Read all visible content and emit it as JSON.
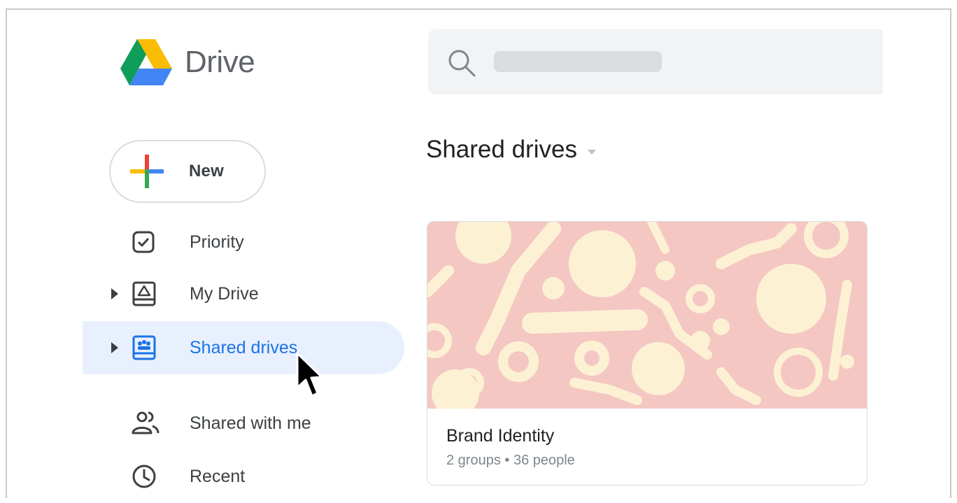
{
  "app": {
    "name": "Drive"
  },
  "search": {
    "value": ""
  },
  "new_button": {
    "label": "New"
  },
  "nav": {
    "items": [
      {
        "label": "Priority",
        "icon": "priority-icon",
        "expandable": false,
        "active": false
      },
      {
        "label": "My Drive",
        "icon": "my-drive-icon",
        "expandable": true,
        "active": false
      },
      {
        "label": "Shared drives",
        "icon": "shared-drives-icon",
        "expandable": true,
        "active": true
      },
      {
        "label": "Shared with me",
        "icon": "shared-with-me-icon",
        "expandable": false,
        "active": false
      },
      {
        "label": "Recent",
        "icon": "recent-icon",
        "expandable": false,
        "active": false
      }
    ]
  },
  "main": {
    "title": "Shared drives",
    "cards": [
      {
        "title": "Brand Identity",
        "subtitle": "2 groups • 36 people",
        "cover_bg": "#f4c7c3",
        "cover_shape": "#fdf1d4"
      }
    ]
  },
  "colors": {
    "accent": "#1a73e8",
    "active_bg": "#e8f0fe",
    "text": "#3c4043",
    "muted": "#80868b"
  }
}
